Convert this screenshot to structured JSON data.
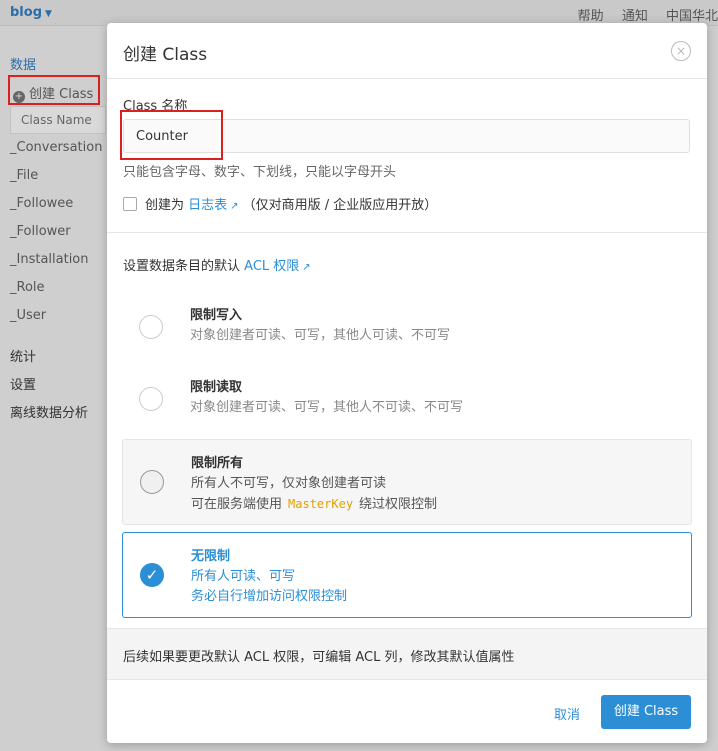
{
  "topbar": {
    "brand": "blog",
    "nav": [
      "帮助",
      "通知",
      "中国华北"
    ]
  },
  "sidebar": {
    "data_label": "数据",
    "create_class": "创建 Class",
    "class_name_placeholder": "Class Name",
    "classes": [
      "_Conversation",
      "_File",
      "_Followee",
      "_Follower",
      "_Installation",
      "_Role",
      "_User"
    ],
    "stats": "统计",
    "settings": "设置",
    "offline": "离线数据分析"
  },
  "modal": {
    "title": "创建 Class",
    "close": "×",
    "name_label": "Class 名称",
    "name_value": "Counter",
    "help": "只能包含字母、数字、下划线，只能以字母开头",
    "log_prefix": "创建为",
    "log_link": "日志表",
    "log_suffix": "（仅对商用版 / 企业版应用开放）",
    "acl_prefix": "设置数据条目的默认",
    "acl_link": "ACL 权限",
    "options": [
      {
        "title": "限制写入",
        "desc": "对象创建者可读、可写，其他人可读、不可写"
      },
      {
        "title": "限制读取",
        "desc": "对象创建者可读、可写，其他人不可读、不可写"
      },
      {
        "title": "限制所有",
        "desc": "所有人不可写，仅对象创建者可读",
        "desc2_pre": "可在服务端使用",
        "desc2_code": "MasterKey",
        "desc2_post": "绕过权限控制"
      },
      {
        "title": "无限制",
        "desc": "所有人可读、可写",
        "desc2": "务必自行增加访问权限控制"
      }
    ],
    "footer_note": "后续如果要更改默认 ACL 权限，可编辑 ACL 列，修改其默认值属性",
    "cancel": "取消",
    "submit": "创建 Class"
  },
  "colors": {
    "accent": "#2c8fd6",
    "highlight": "#d9211f",
    "code": "#e0a000"
  }
}
